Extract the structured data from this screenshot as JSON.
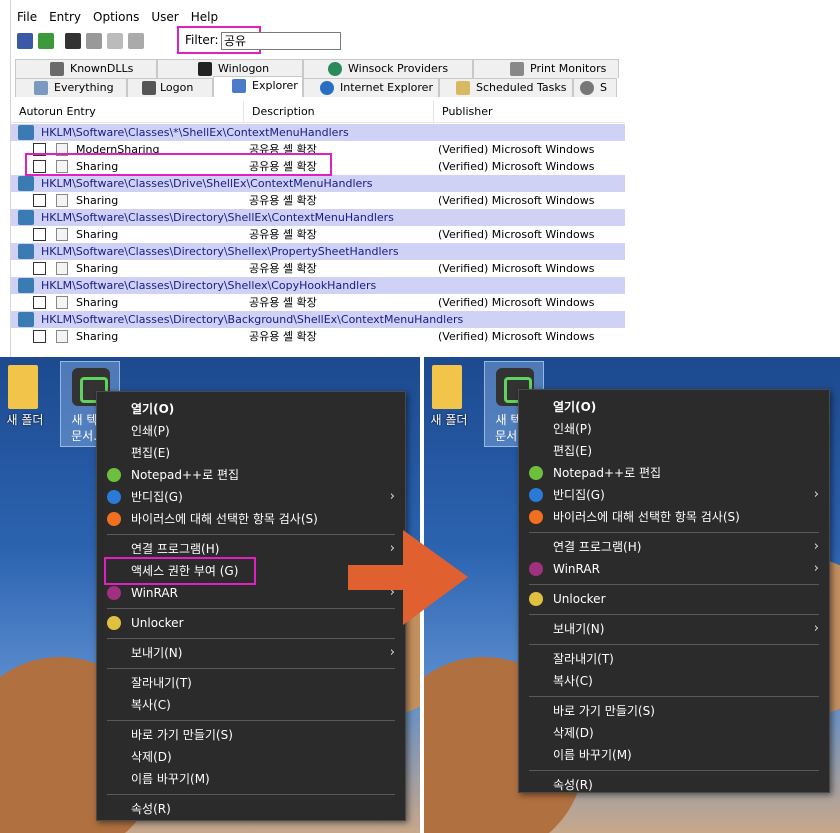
{
  "menubar": [
    "File",
    "Entry",
    "Options",
    "User",
    "Help"
  ],
  "filter": {
    "label": "Filter:",
    "value": "공유"
  },
  "tabs_row1": [
    "KnownDLLs",
    "Winlogon",
    "Winsock Providers",
    "Print Monitors"
  ],
  "tabs_row2": [
    "Everything",
    "Logon",
    "Explorer",
    "Internet Explorer",
    "Scheduled Tasks",
    "S"
  ],
  "columns": [
    "Autorun Entry",
    "Description",
    "Publisher"
  ],
  "entries": [
    {
      "type": "key",
      "text": "HKLM\\Software\\Classes\\*\\ShellEx\\ContextMenuHandlers"
    },
    {
      "type": "item",
      "name": "ModernSharing",
      "desc": "공유용 셸 확장",
      "pub": "(Verified) Microsoft Windows"
    },
    {
      "type": "item",
      "name": "Sharing",
      "desc": "공유용 셸 확장",
      "pub": "(Verified) Microsoft Windows"
    },
    {
      "type": "key",
      "text": "HKLM\\Software\\Classes\\Drive\\ShellEx\\ContextMenuHandlers"
    },
    {
      "type": "item",
      "name": "Sharing",
      "desc": "공유용 셸 확장",
      "pub": "(Verified) Microsoft Windows"
    },
    {
      "type": "key",
      "text": "HKLM\\Software\\Classes\\Directory\\ShellEx\\ContextMenuHandlers"
    },
    {
      "type": "item",
      "name": "Sharing",
      "desc": "공유용 셸 확장",
      "pub": "(Verified) Microsoft Windows"
    },
    {
      "type": "key",
      "text": "HKLM\\Software\\Classes\\Directory\\Shellex\\PropertySheetHandlers"
    },
    {
      "type": "item",
      "name": "Sharing",
      "desc": "공유용 셸 확장",
      "pub": "(Verified) Microsoft Windows"
    },
    {
      "type": "key",
      "text": "HKLM\\Software\\Classes\\Directory\\Shellex\\CopyHookHandlers"
    },
    {
      "type": "item",
      "name": "Sharing",
      "desc": "공유용 셸 확장",
      "pub": "(Verified) Microsoft Windows"
    },
    {
      "type": "key",
      "text": "HKLM\\Software\\Classes\\Directory\\Background\\ShellEx\\ContextMenuHandlers"
    },
    {
      "type": "item",
      "name": "Sharing",
      "desc": "공유용 셸 확장",
      "pub": "(Verified) Microsoft Windows"
    }
  ],
  "desktop": {
    "folder_label": "새 폴더",
    "file_label_1": "새 텍스",
    "file_label_2": "문서.tx"
  },
  "menu_before": [
    {
      "label": "열기(O)",
      "bold": true
    },
    {
      "label": "인쇄(P)"
    },
    {
      "label": "편집(E)"
    },
    {
      "label": "Notepad++로 편집",
      "icon": "notepadpp-icon"
    },
    {
      "label": "반디집(G)",
      "icon": "bandizip-icon",
      "sub": true
    },
    {
      "label": "바이러스에 대해 선택한 항목 검사(S)",
      "icon": "avast-icon"
    },
    {
      "sep": true
    },
    {
      "label": "연결 프로그램(H)",
      "sub": true
    },
    {
      "label": "액세스 권한 부여 (G)",
      "sub": true
    },
    {
      "label": "WinRAR",
      "icon": "winrar-icon",
      "sub": true
    },
    {
      "sep": true
    },
    {
      "label": "Unlocker",
      "icon": "unlocker-icon"
    },
    {
      "sep": true
    },
    {
      "label": "보내기(N)",
      "sub": true
    },
    {
      "sep": true
    },
    {
      "label": "잘라내기(T)"
    },
    {
      "label": "복사(C)"
    },
    {
      "sep": true
    },
    {
      "label": "바로 가기 만들기(S)"
    },
    {
      "label": "삭제(D)"
    },
    {
      "label": "이름 바꾸기(M)"
    },
    {
      "sep": true
    },
    {
      "label": "속성(R)"
    }
  ],
  "menu_after": [
    {
      "label": "열기(O)",
      "bold": true
    },
    {
      "label": "인쇄(P)"
    },
    {
      "label": "편집(E)"
    },
    {
      "label": "Notepad++로 편집",
      "icon": "notepadpp-icon"
    },
    {
      "label": "반디집(G)",
      "icon": "bandizip-icon",
      "sub": true
    },
    {
      "label": "바이러스에 대해 선택한 항목 검사(S)",
      "icon": "avast-icon"
    },
    {
      "sep": true
    },
    {
      "label": "연결 프로그램(H)",
      "sub": true
    },
    {
      "label": "WinRAR",
      "icon": "winrar-icon",
      "sub": true
    },
    {
      "sep": true
    },
    {
      "label": "Unlocker",
      "icon": "unlocker-icon"
    },
    {
      "sep": true
    },
    {
      "label": "보내기(N)",
      "sub": true
    },
    {
      "sep": true
    },
    {
      "label": "잘라내기(T)"
    },
    {
      "label": "복사(C)"
    },
    {
      "sep": true
    },
    {
      "label": "바로 가기 만들기(S)"
    },
    {
      "label": "삭제(D)"
    },
    {
      "label": "이름 바꾸기(M)"
    },
    {
      "sep": true
    },
    {
      "label": "속성(R)"
    }
  ],
  "colors": {
    "highlight": "#e020c0",
    "key_row": "#cfd2f4",
    "menu_bg": "#2b2b2b",
    "arrow": "#e06030"
  }
}
